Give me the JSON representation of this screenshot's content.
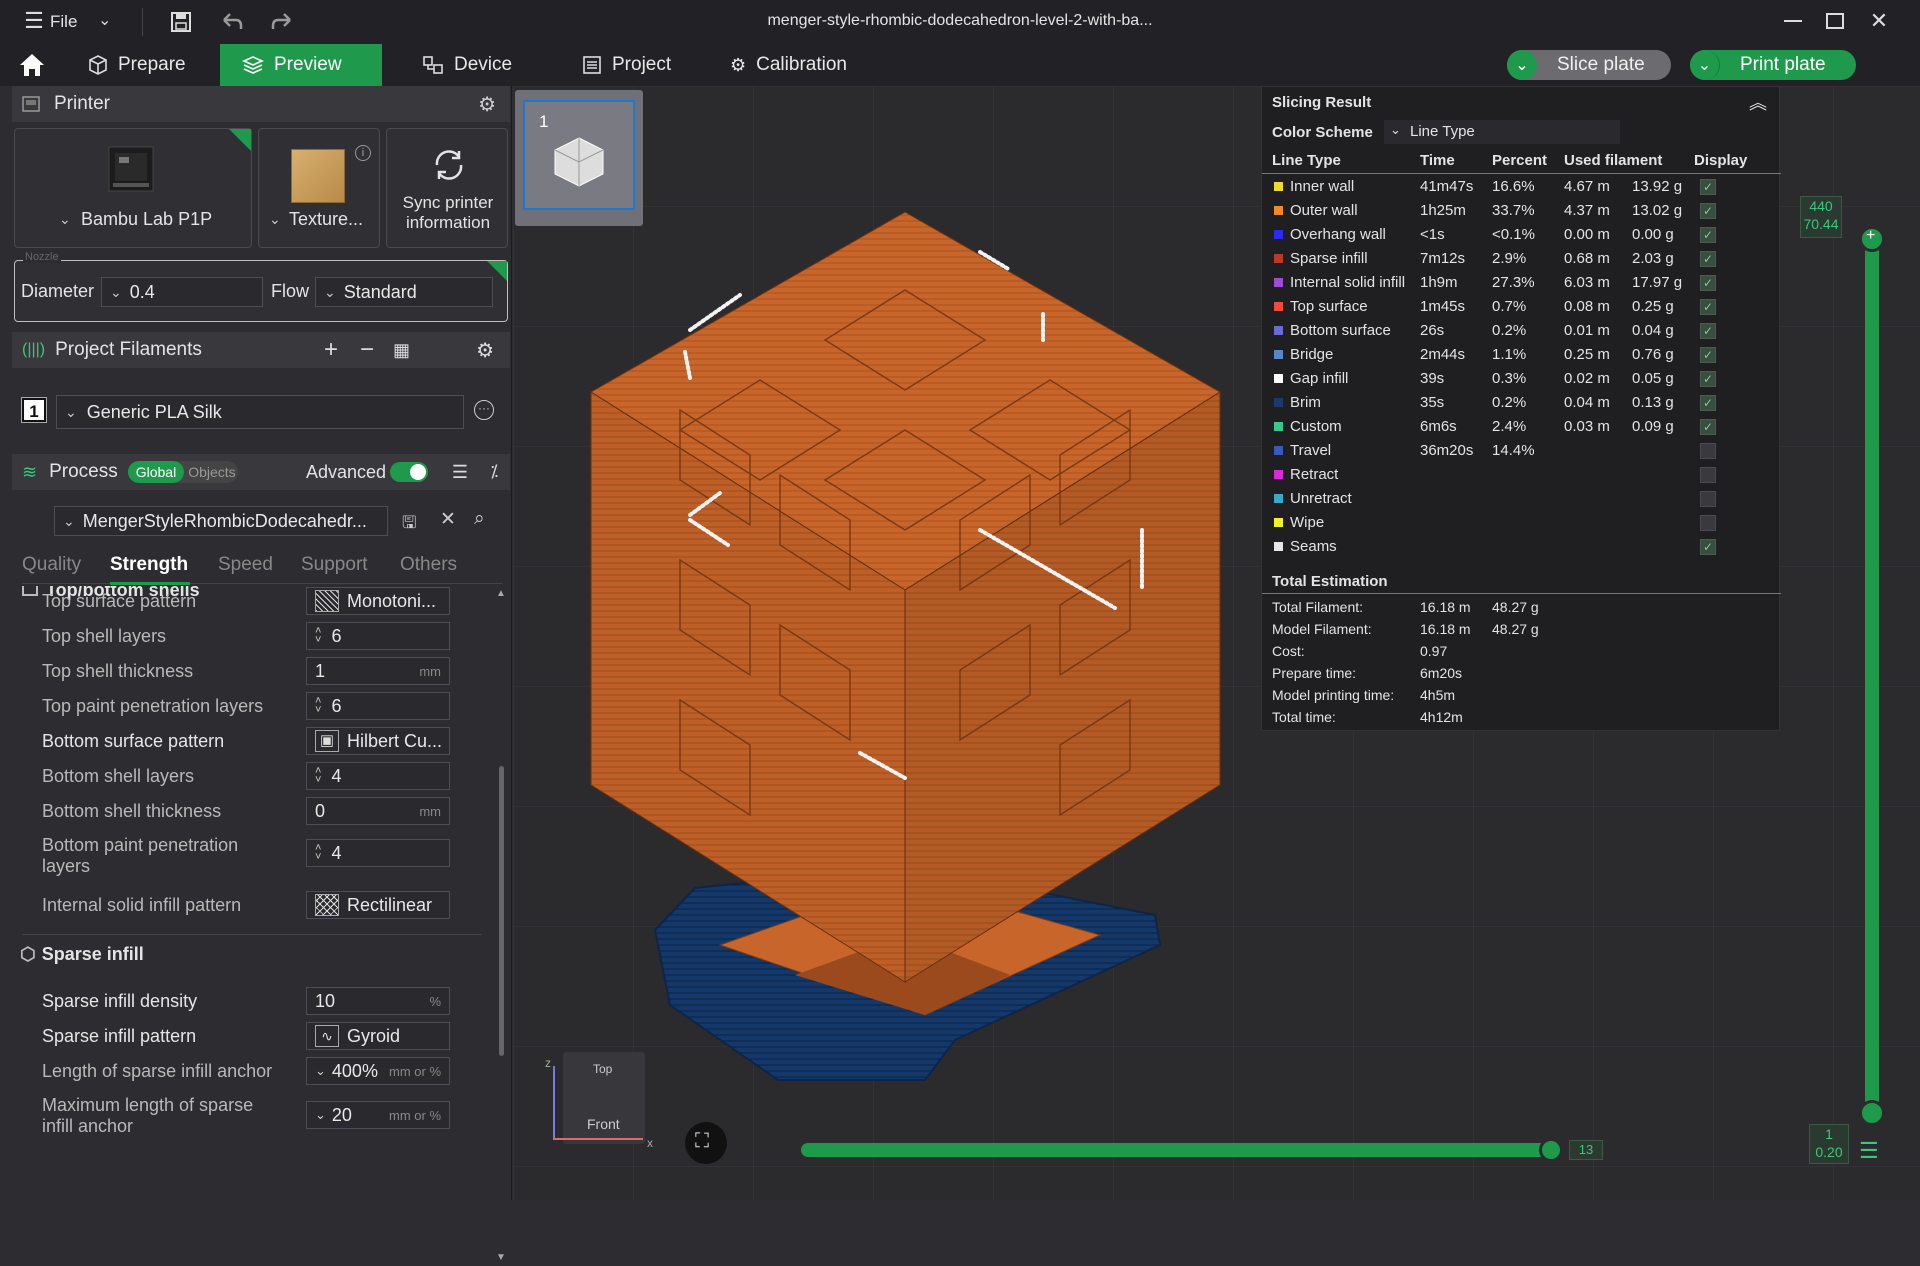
{
  "window": {
    "title": "menger-style-rhombic-dodecahedron-level-2-with-ba...",
    "file_label": "File"
  },
  "nav": {
    "tabs": [
      {
        "label": "Prepare"
      },
      {
        "label": "Preview"
      },
      {
        "label": "Device"
      },
      {
        "label": "Project"
      },
      {
        "label": "Calibration"
      }
    ],
    "slice_label": "Slice plate",
    "print_label": "Print plate"
  },
  "printer": {
    "section_label": "Printer",
    "name": "Bambu Lab P1P",
    "plate": "Texture...",
    "sync_label": "Sync printer information",
    "nozzle_label": "Nozzle",
    "diameter_label": "Diameter",
    "diameter_value": "0.4",
    "flow_label": "Flow",
    "flow_value": "Standard"
  },
  "filaments": {
    "section_label": "Project Filaments",
    "slot": "1",
    "name": "Generic PLA Silk"
  },
  "process": {
    "section_label": "Process",
    "toggle_global": "Global",
    "toggle_objects": "Objects",
    "advanced_label": "Advanced",
    "advanced_on": true,
    "preset": "MengerStyleRhombicDodecahedr...",
    "tabs": [
      "Quality",
      "Strength",
      "Speed",
      "Support",
      "Others"
    ],
    "active_tab": "Strength",
    "group_topbottom": "Top/bottom shells",
    "group_sparse": "Sparse infill",
    "settings": [
      {
        "label": "Top surface pattern",
        "value": "Monotoni...",
        "kind": "pattern"
      },
      {
        "label": "Top shell layers",
        "value": "6",
        "kind": "spin"
      },
      {
        "label": "Top shell thickness",
        "value": "1",
        "unit": "mm",
        "kind": "plain"
      },
      {
        "label": "Top paint penetration layers",
        "value": "6",
        "kind": "spin"
      },
      {
        "label": "Bottom surface pattern",
        "value": "Hilbert Cu...",
        "kind": "pattern"
      },
      {
        "label": "Bottom shell layers",
        "value": "4",
        "kind": "spin"
      },
      {
        "label": "Bottom shell thickness",
        "value": "0",
        "unit": "mm",
        "kind": "plain"
      },
      {
        "label": "Bottom paint penetration layers",
        "value": "4",
        "kind": "spin"
      },
      {
        "label": "Internal solid infill pattern",
        "value": "Rectilinear",
        "kind": "pattern"
      },
      {
        "label": "Sparse infill density",
        "value": "10",
        "unit": "%",
        "kind": "plain"
      },
      {
        "label": "Sparse infill pattern",
        "value": "Gyroid",
        "kind": "pattern"
      },
      {
        "label": "Length of sparse infill anchor",
        "value": "400%",
        "unit": "mm or %",
        "kind": "combo"
      },
      {
        "label": "Maximum length of sparse infill anchor",
        "value": "20",
        "unit": "mm or %",
        "kind": "combo"
      }
    ]
  },
  "plate_thumb": {
    "number": "1"
  },
  "slicing": {
    "title": "Slicing Result",
    "color_scheme_label": "Color Scheme",
    "color_scheme_value": "Line Type",
    "headers": [
      "Line Type",
      "Time",
      "Percent",
      "Used filament",
      "Display"
    ],
    "rows": [
      {
        "name": "Inner wall",
        "color": "#f2d632",
        "time": "41m47s",
        "percent": "16.6%",
        "len": "4.67 m",
        "weight": "13.92 g",
        "display": true
      },
      {
        "name": "Outer wall",
        "color": "#f28a2a",
        "time": "1h25m",
        "percent": "33.7%",
        "len": "4.37 m",
        "weight": "13.02 g",
        "display": true
      },
      {
        "name": "Overhang wall",
        "color": "#2a2af2",
        "time": "<1s",
        "percent": "<0.1%",
        "len": "0.00 m",
        "weight": "0.00 g",
        "display": true
      },
      {
        "name": "Sparse infill",
        "color": "#b83a2a",
        "time": "7m12s",
        "percent": "2.9%",
        "len": "0.68 m",
        "weight": "2.03 g",
        "display": true
      },
      {
        "name": "Internal solid infill",
        "color": "#a04ad8",
        "time": "1h9m",
        "percent": "27.3%",
        "len": "6.03 m",
        "weight": "17.97 g",
        "display": true
      },
      {
        "name": "Top surface",
        "color": "#f24a3a",
        "time": "1m45s",
        "percent": "0.7%",
        "len": "0.08 m",
        "weight": "0.25 g",
        "display": true
      },
      {
        "name": "Bottom surface",
        "color": "#6a6ad8",
        "time": "26s",
        "percent": "0.2%",
        "len": "0.01 m",
        "weight": "0.04 g",
        "display": true
      },
      {
        "name": "Bridge",
        "color": "#5a86c8",
        "time": "2m44s",
        "percent": "1.1%",
        "len": "0.25 m",
        "weight": "0.76 g",
        "display": true
      },
      {
        "name": "Gap infill",
        "color": "#ffffff",
        "time": "39s",
        "percent": "0.3%",
        "len": "0.02 m",
        "weight": "0.05 g",
        "display": true
      },
      {
        "name": "Brim",
        "color": "#1a3a6a",
        "time": "35s",
        "percent": "0.2%",
        "len": "0.04 m",
        "weight": "0.13 g",
        "display": true
      },
      {
        "name": "Custom",
        "color": "#3ac88a",
        "time": "6m6s",
        "percent": "2.4%",
        "len": "0.03 m",
        "weight": "0.09 g",
        "display": true
      },
      {
        "name": "Travel",
        "color": "#3a5ab8",
        "time": "36m20s",
        "percent": "14.4%",
        "len": "",
        "weight": "",
        "display": false
      },
      {
        "name": "Retract",
        "color": "#d82ad8",
        "time": "",
        "percent": "",
        "len": "",
        "weight": "",
        "display": false
      },
      {
        "name": "Unretract",
        "color": "#3aa8c8",
        "time": "",
        "percent": "",
        "len": "",
        "weight": "",
        "display": false
      },
      {
        "name": "Wipe",
        "color": "#f2f22a",
        "time": "",
        "percent": "",
        "len": "",
        "weight": "",
        "display": false
      },
      {
        "name": "Seams",
        "color": "#e6e6e6",
        "time": "",
        "percent": "",
        "len": "",
        "weight": "",
        "display": true
      }
    ],
    "total_title": "Total Estimation",
    "totals": [
      {
        "label": "Total Filament:",
        "v1": "16.18 m",
        "v2": "48.27 g"
      },
      {
        "label": "Model Filament:",
        "v1": "16.18 m",
        "v2": "48.27 g"
      },
      {
        "label": "Cost:",
        "v1": "0.97",
        "v2": ""
      },
      {
        "label": "Prepare time:",
        "v1": "6m20s",
        "v2": ""
      },
      {
        "label": "Model printing time:",
        "v1": "4h5m",
        "v2": ""
      },
      {
        "label": "Total time:",
        "v1": "4h12m",
        "v2": ""
      }
    ]
  },
  "layer_slider": {
    "top_layer": "440",
    "top_height": "70.44",
    "bottom_layer": "1",
    "bottom_height": "0.20",
    "move_value": "13"
  },
  "axes": {
    "top_label": "Top",
    "front_label": "Front",
    "x": "x",
    "z": "z"
  },
  "colors": {
    "accent": "#1f9a4c",
    "model": "#c8652a",
    "brim": "#15386b"
  }
}
